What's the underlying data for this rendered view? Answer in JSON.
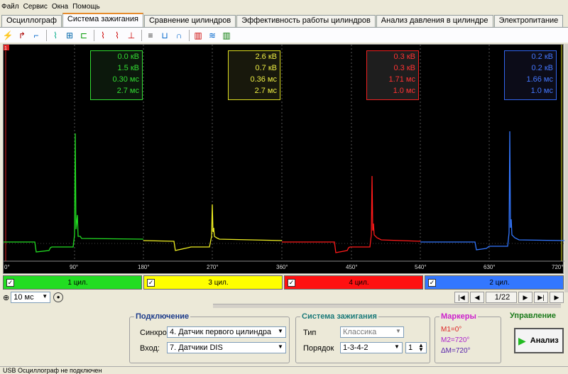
{
  "menu": [
    "Файл",
    "Сервис",
    "Окна",
    "Помощь"
  ],
  "tabs": [
    {
      "label": "Осциллограф",
      "active": false
    },
    {
      "label": "Система зажигания",
      "active": true
    },
    {
      "label": "Сравнение цилиндров",
      "active": false
    },
    {
      "label": "Эффективность работы цилиндров",
      "active": false
    },
    {
      "label": "Анализ давления в цилиндре",
      "active": false
    },
    {
      "label": "Электропитание",
      "active": false
    }
  ],
  "scope": {
    "cursor_marker": "1",
    "x_ticks": [
      "0°",
      "90°",
      "180°",
      "270°",
      "360°",
      "450°",
      "540°",
      "630°",
      "720°"
    ],
    "readouts": [
      {
        "color": "#33dd33",
        "lines": [
          "0.0 кВ",
          "1.5 кВ",
          "0.30 мс",
          "2.7 мс"
        ]
      },
      {
        "color": "#dddd22",
        "lines": [
          "2.6 кВ",
          "0.7 кВ",
          "0.36 мс",
          "2.7 мс"
        ]
      },
      {
        "color": "#ee2222",
        "lines": [
          "0.3 кВ",
          "0.3 кВ",
          "1.71 мс",
          "1.0 мс"
        ]
      },
      {
        "color": "#3366ee",
        "lines": [
          "0.2 кВ",
          "0.2 кВ",
          "1.66 мс",
          "1.0 мс"
        ]
      }
    ]
  },
  "cylinders": [
    {
      "label": "1 цил.",
      "color": "#22dd22"
    },
    {
      "label": "3 цил.",
      "color": "#ffff00"
    },
    {
      "label": "4 цил.",
      "color": "#ff1111"
    },
    {
      "label": "2 цил.",
      "color": "#3377ff"
    }
  ],
  "controls": {
    "timebase": "10 мс",
    "page": "1/22"
  },
  "connection": {
    "title": "Подключение",
    "sync_label": "Синхро:",
    "sync_value": "4. Датчик первого цилиндра",
    "input_label": "Вход:",
    "input_value": "7. Датчики DIS"
  },
  "ignition": {
    "title": "Система зажигания",
    "type_label": "Тип",
    "type_value": "Классика",
    "order_label": "Порядок",
    "order_value": "1-3-4-2",
    "order_spin": "1"
  },
  "markers": {
    "title": "Маркеры",
    "m1": "M1=0°",
    "m2": "M2=720°",
    "dm": "ΔM=720°"
  },
  "control": {
    "title": "Управление",
    "analyze_label": "Анализ"
  },
  "status": "USB Осциллограф не подключен"
}
